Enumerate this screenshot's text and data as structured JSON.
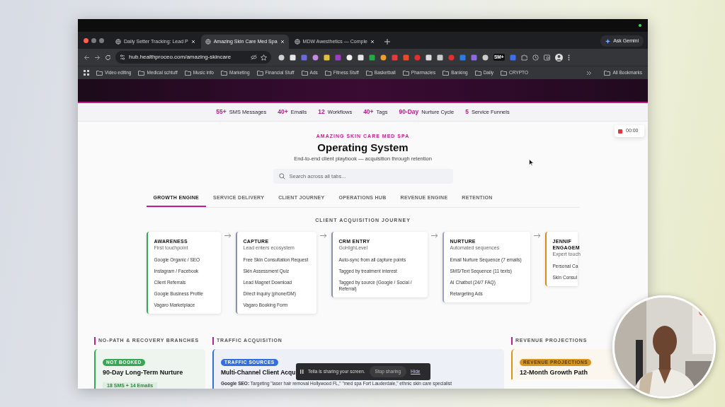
{
  "browser": {
    "tabs": [
      {
        "title": "Daily Setter Tracking: Lead P",
        "selected": false
      },
      {
        "title": "Amazing Skin Care Med Spa",
        "selected": true
      },
      {
        "title": "MDW Awesthetics — Comple",
        "selected": false
      }
    ],
    "gemini_button": "Ask Gemini",
    "url": "hub.healthproceo.com/amazing-skincare",
    "extension_badge": "SM+",
    "bookmarks": [
      "Video editing",
      "Medical schtuff",
      "Music info",
      "Marketing",
      "Financial Stuff",
      "Ads",
      "Fitness Stuff",
      "Basketball",
      "Pharmacies",
      "Banking",
      "Daily",
      "CRYPTO"
    ],
    "all_bookmarks": "All Bookmarks"
  },
  "stats": [
    {
      "value": "55+",
      "label": "SMS Messages"
    },
    {
      "value": "40+",
      "label": "Emails"
    },
    {
      "value": "12",
      "label": "Workflows"
    },
    {
      "value": "40+",
      "label": "Tags"
    },
    {
      "value": "90-Day",
      "label": "Nurture Cycle"
    },
    {
      "value": "5",
      "label": "Service Funnels"
    }
  ],
  "recording": {
    "time": "00:00"
  },
  "eyebrow": "AMAZING SKIN CARE MED SPA",
  "title": "Operating System",
  "subtitle": "End-to-end client playbook — acquisition through retention",
  "search": {
    "placeholder": "Search across all tabs..."
  },
  "nav_tabs": [
    {
      "label": "GROWTH ENGINE",
      "selected": true
    },
    {
      "label": "SERVICE DELIVERY",
      "selected": false
    },
    {
      "label": "CLIENT JOURNEY",
      "selected": false
    },
    {
      "label": "OPERATIONS HUB",
      "selected": false
    },
    {
      "label": "REVENUE ENGINE",
      "selected": false
    },
    {
      "label": "RETENTION",
      "selected": false
    }
  ],
  "journey": {
    "title": "CLIENT ACQUISITION JOURNEY",
    "stages": [
      {
        "title": "AWARENESS",
        "subtitle": "First touchpoint",
        "color": "#35a853",
        "items": [
          "Google Organic / SEO",
          "Instagram / Facebook",
          "Client Referrals",
          "Google Business Profile",
          "Vagaro Marketplace"
        ]
      },
      {
        "title": "CAPTURE",
        "subtitle": "Lead enters ecosystem",
        "color": "#8c90a6",
        "items": [
          "Free Skin Consultation Request",
          "Skin Assessment Quiz",
          "Lead Magnet Download",
          "Direct Inquiry (phone/DM)",
          "Vagaro Booking Form"
        ]
      },
      {
        "title": "CRM ENTRY",
        "subtitle": "GoHighLevel",
        "color": "#8c90ac",
        "items": [
          "Auto-sync from all capture points",
          "Tagged by treatment interest",
          "Tagged by source (Google / Social / Referral)"
        ]
      },
      {
        "title": "NURTURE",
        "subtitle": "Automated sequences",
        "color": "#9ca2c4",
        "items": [
          "Email Nurture Sequence (7 emails)",
          "SMS/Text Sequence (11 texts)",
          "AI Chatbot (24/7 FAQ)",
          "Retargeting Ads"
        ]
      },
      {
        "title": "JENNIF\nENGAGEM",
        "subtitle": "Expert touch",
        "color": "#d58a1c",
        "items": [
          "Personal Ca",
          "Skin Consul"
        ]
      }
    ]
  },
  "sections": [
    {
      "heading": "NO-PATH & RECOVERY BRANCHES",
      "color": "#35a853",
      "badge": "NOT BOOKED",
      "card_title": "90-Day Long-Term Nurture",
      "chip": "18 SMS + 14 Emails"
    },
    {
      "heading": "TRAFFIC ACQUISITION",
      "color": "#2f6fe0",
      "badge": "TRAFFIC SOURCES",
      "card_title": "Multi-Channel Client Acqu",
      "body": "**Google SEO:** Targeting \"laser hair removal Hollywood FL,\" \"med spa Fort Lauderdale,\" ethnic skin care specialist"
    },
    {
      "heading": "REVENUE PROJECTIONS",
      "color": "#d8951c",
      "badge": "REVENUE PROJECTIONS",
      "card_title": "12-Month Growth Path"
    }
  ],
  "share_bar": {
    "message": "Tella is sharing your screen.",
    "stop_button": "Stop sharing",
    "hide_link": "Hide"
  }
}
